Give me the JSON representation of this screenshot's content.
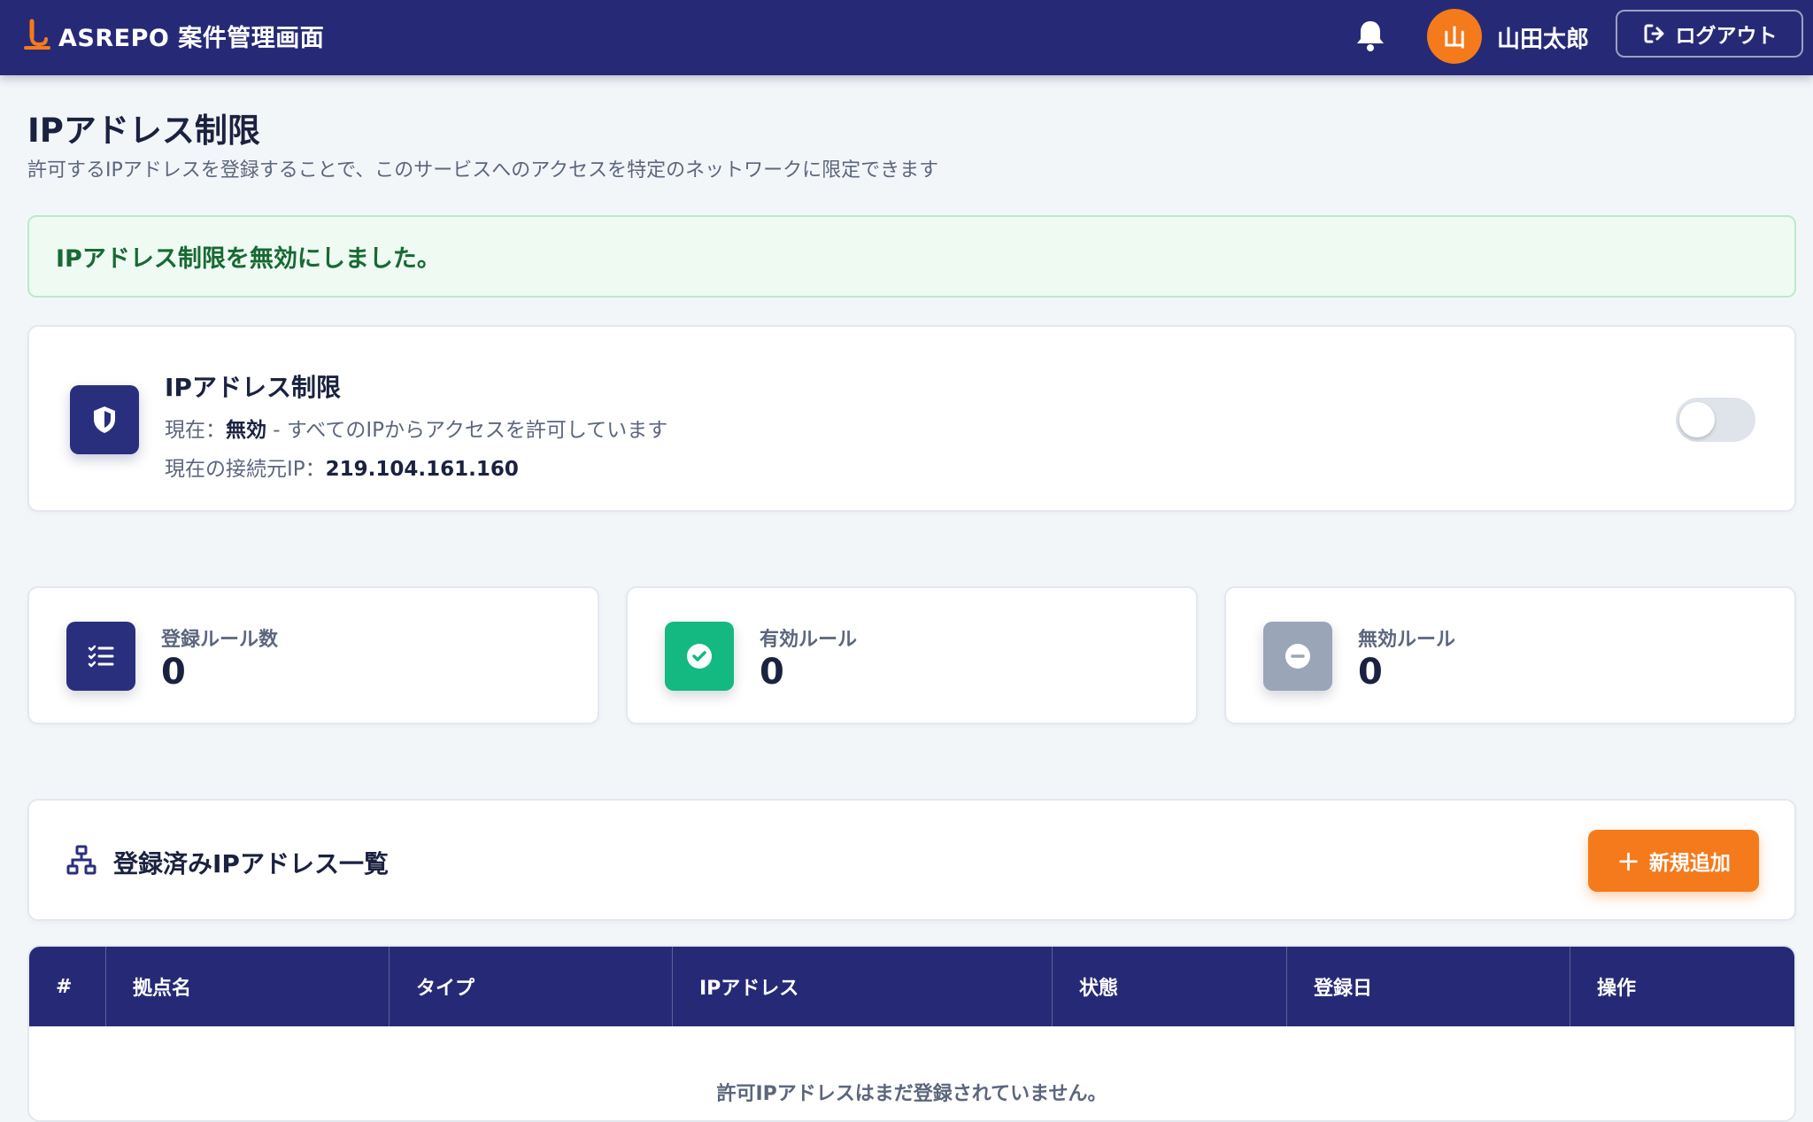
{
  "header": {
    "brand_title": "ASREPO 案件管理画面",
    "user_initial": "山",
    "user_name": "山田太郎",
    "logout_label": "ログアウト"
  },
  "page": {
    "title": "IPアドレス制限",
    "description": "許可するIPアドレスを登録することで、このサービスへのアクセスを特定のネットワークに限定できます"
  },
  "alert": {
    "message": "IPアドレス制限を無効にしました。",
    "status": "success"
  },
  "restriction": {
    "title": "IPアドレス制限",
    "status_prefix": "現在：",
    "status_value": "無効",
    "status_suffix": " - すべてのIPからアクセスを許可しています",
    "ip_prefix": "現在の接続元IP：",
    "ip_value": "219.104.161.160",
    "enabled": false
  },
  "stats": [
    {
      "label": "登録ルール数",
      "value": "0",
      "icon": "list-check-icon",
      "color": "#2a2f7d"
    },
    {
      "label": "有効ルール",
      "value": "0",
      "icon": "check-circle-icon",
      "color": "#13b981"
    },
    {
      "label": "無効ルール",
      "value": "0",
      "icon": "minus-circle-icon",
      "color": "#9aa5b8"
    }
  ],
  "list": {
    "title": "登録済みIPアドレス一覧",
    "add_label": "新規追加"
  },
  "table": {
    "columns": [
      "#",
      "拠点名",
      "タイプ",
      "IPアドレス",
      "状態",
      "登録日",
      "操作"
    ],
    "empty_message": "許可IPアドレスはまだ登録されていません。"
  },
  "colors": {
    "primary": "#262a76",
    "accent": "#f57a1c",
    "success": "#13b981"
  }
}
